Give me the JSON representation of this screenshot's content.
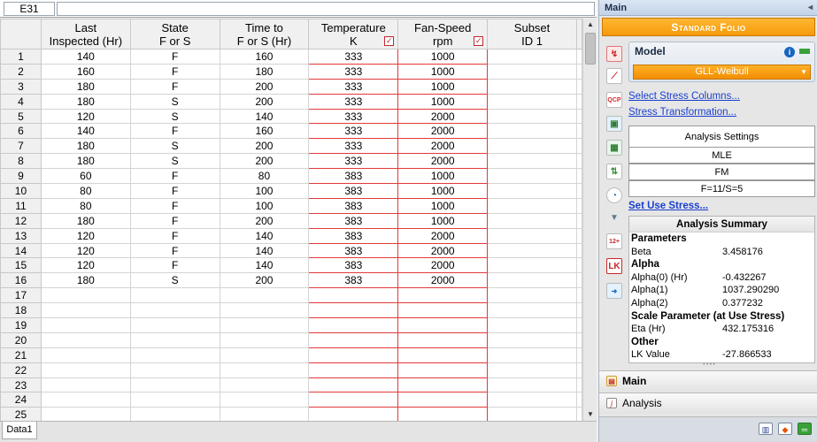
{
  "cell_reference": "E31",
  "formula_value": "",
  "columns": [
    {
      "line1": "Last",
      "line2": "Inspected (Hr)",
      "checkbox": false
    },
    {
      "line1": "State",
      "line2": "F or S",
      "checkbox": false
    },
    {
      "line1": "Time to",
      "line2": "F or S (Hr)",
      "checkbox": false
    },
    {
      "line1": "Temperature",
      "line2": "K",
      "checkbox": true
    },
    {
      "line1": "Fan-Speed",
      "line2": "rpm",
      "checkbox": true
    },
    {
      "line1": "Subset",
      "line2": "ID 1",
      "checkbox": false
    }
  ],
  "checkbox_mark": "✓",
  "rows": [
    [
      "140",
      "F",
      "160",
      "333",
      "1000",
      ""
    ],
    [
      "160",
      "F",
      "180",
      "333",
      "1000",
      ""
    ],
    [
      "180",
      "F",
      "200",
      "333",
      "1000",
      ""
    ],
    [
      "180",
      "S",
      "200",
      "333",
      "1000",
      ""
    ],
    [
      "120",
      "S",
      "140",
      "333",
      "2000",
      ""
    ],
    [
      "140",
      "F",
      "160",
      "333",
      "2000",
      ""
    ],
    [
      "180",
      "S",
      "200",
      "333",
      "2000",
      ""
    ],
    [
      "180",
      "S",
      "200",
      "333",
      "2000",
      ""
    ],
    [
      "60",
      "F",
      "80",
      "383",
      "1000",
      ""
    ],
    [
      "80",
      "F",
      "100",
      "383",
      "1000",
      ""
    ],
    [
      "80",
      "F",
      "100",
      "383",
      "1000",
      ""
    ],
    [
      "180",
      "F",
      "200",
      "383",
      "1000",
      ""
    ],
    [
      "120",
      "F",
      "140",
      "383",
      "2000",
      ""
    ],
    [
      "120",
      "F",
      "140",
      "383",
      "2000",
      ""
    ],
    [
      "120",
      "F",
      "140",
      "383",
      "2000",
      ""
    ],
    [
      "180",
      "S",
      "200",
      "383",
      "2000",
      ""
    ],
    [
      "",
      "",
      "",
      "",
      "",
      ""
    ],
    [
      "",
      "",
      "",
      "",
      "",
      ""
    ],
    [
      "",
      "",
      "",
      "",
      "",
      ""
    ],
    [
      "",
      "",
      "",
      "",
      "",
      ""
    ],
    [
      "",
      "",
      "",
      "",
      "",
      ""
    ],
    [
      "",
      "",
      "",
      "",
      "",
      ""
    ],
    [
      "",
      "",
      "",
      "",
      "",
      ""
    ],
    [
      "",
      "",
      "",
      "",
      "",
      ""
    ],
    [
      "",
      "",
      "",
      "",
      "",
      ""
    ]
  ],
  "row_numbers": [
    "1",
    "2",
    "3",
    "4",
    "5",
    "6",
    "7",
    "8",
    "9",
    "10",
    "11",
    "12",
    "13",
    "14",
    "15",
    "16",
    "17",
    "18",
    "19",
    "20",
    "21",
    "22",
    "23",
    "24",
    "25"
  ],
  "sheet_tab": "Data1",
  "panel": {
    "title": "Main",
    "pin_icon": "◂",
    "banner": "Standard Folio",
    "model_label": "Model",
    "info_glyph": "i",
    "model_value": "GLL-Weibull",
    "dropdown_glyph": "▼",
    "link_select_stress": "Select Stress Columns...",
    "link_stress_transformation": "Stress Transformation...",
    "analysis_settings_label": "Analysis Settings",
    "settings": [
      "MLE",
      "FM",
      "F=11/S=5"
    ],
    "link_set_use_stress": "Set Use Stress...",
    "summary_title": "Analysis Summary",
    "summary": [
      {
        "type": "group",
        "label": "Parameters"
      },
      {
        "type": "row",
        "label": "Beta",
        "value": "3.458176"
      },
      {
        "type": "group",
        "label": "Alpha"
      },
      {
        "type": "row",
        "label": "Alpha(0) (Hr)",
        "value": "-0.432267"
      },
      {
        "type": "row",
        "label": "Alpha(1)",
        "value": "1037.290290"
      },
      {
        "type": "row",
        "label": "Alpha(2)",
        "value": "0.377232"
      },
      {
        "type": "group",
        "label": "Scale Parameter (at Use Stress)"
      },
      {
        "type": "row",
        "label": "Eta (Hr)",
        "value": "432.175316"
      },
      {
        "type": "group",
        "label": "Other"
      },
      {
        "type": "row",
        "label": "LK Value",
        "value": "-27.866533"
      }
    ],
    "nav_main": "Main",
    "nav_analysis": "Analysis"
  },
  "colors": {
    "accent_orange": "#f59a0a",
    "stress_column_border": "#e23a3a",
    "link_blue": "#1a3fd0"
  },
  "icons": [
    "calculate-icon",
    "plot-icon",
    "qcp-icon",
    "report-icon",
    "batch-icon",
    "transfer-icon",
    "gauge-icon",
    "filter-icon",
    "number-icon",
    "lk-icon",
    "export-icon"
  ]
}
